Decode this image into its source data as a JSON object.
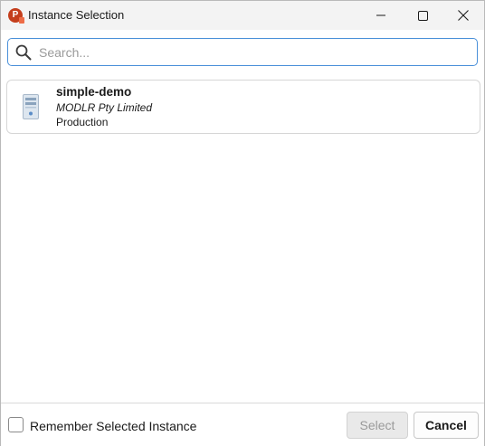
{
  "window": {
    "title": "Instance Selection",
    "app_icon": "powerpoint-icon",
    "controls": {
      "minimize": "minimize-icon",
      "maximize": "maximize-icon",
      "close": "close-icon"
    }
  },
  "search": {
    "placeholder": "Search...",
    "value": "",
    "icon": "search-icon"
  },
  "instances": [
    {
      "name": "simple-demo",
      "organization": "MODLR Pty Limited",
      "environment": "Production",
      "icon": "server-icon"
    }
  ],
  "footer": {
    "remember_label": "Remember Selected Instance",
    "remember_checked": false,
    "select_label": "Select",
    "select_enabled": false,
    "cancel_label": "Cancel"
  },
  "colors": {
    "accent": "#4a90d9",
    "app_icon": "#c43e1c",
    "disabled_text": "#9a9a9a"
  }
}
